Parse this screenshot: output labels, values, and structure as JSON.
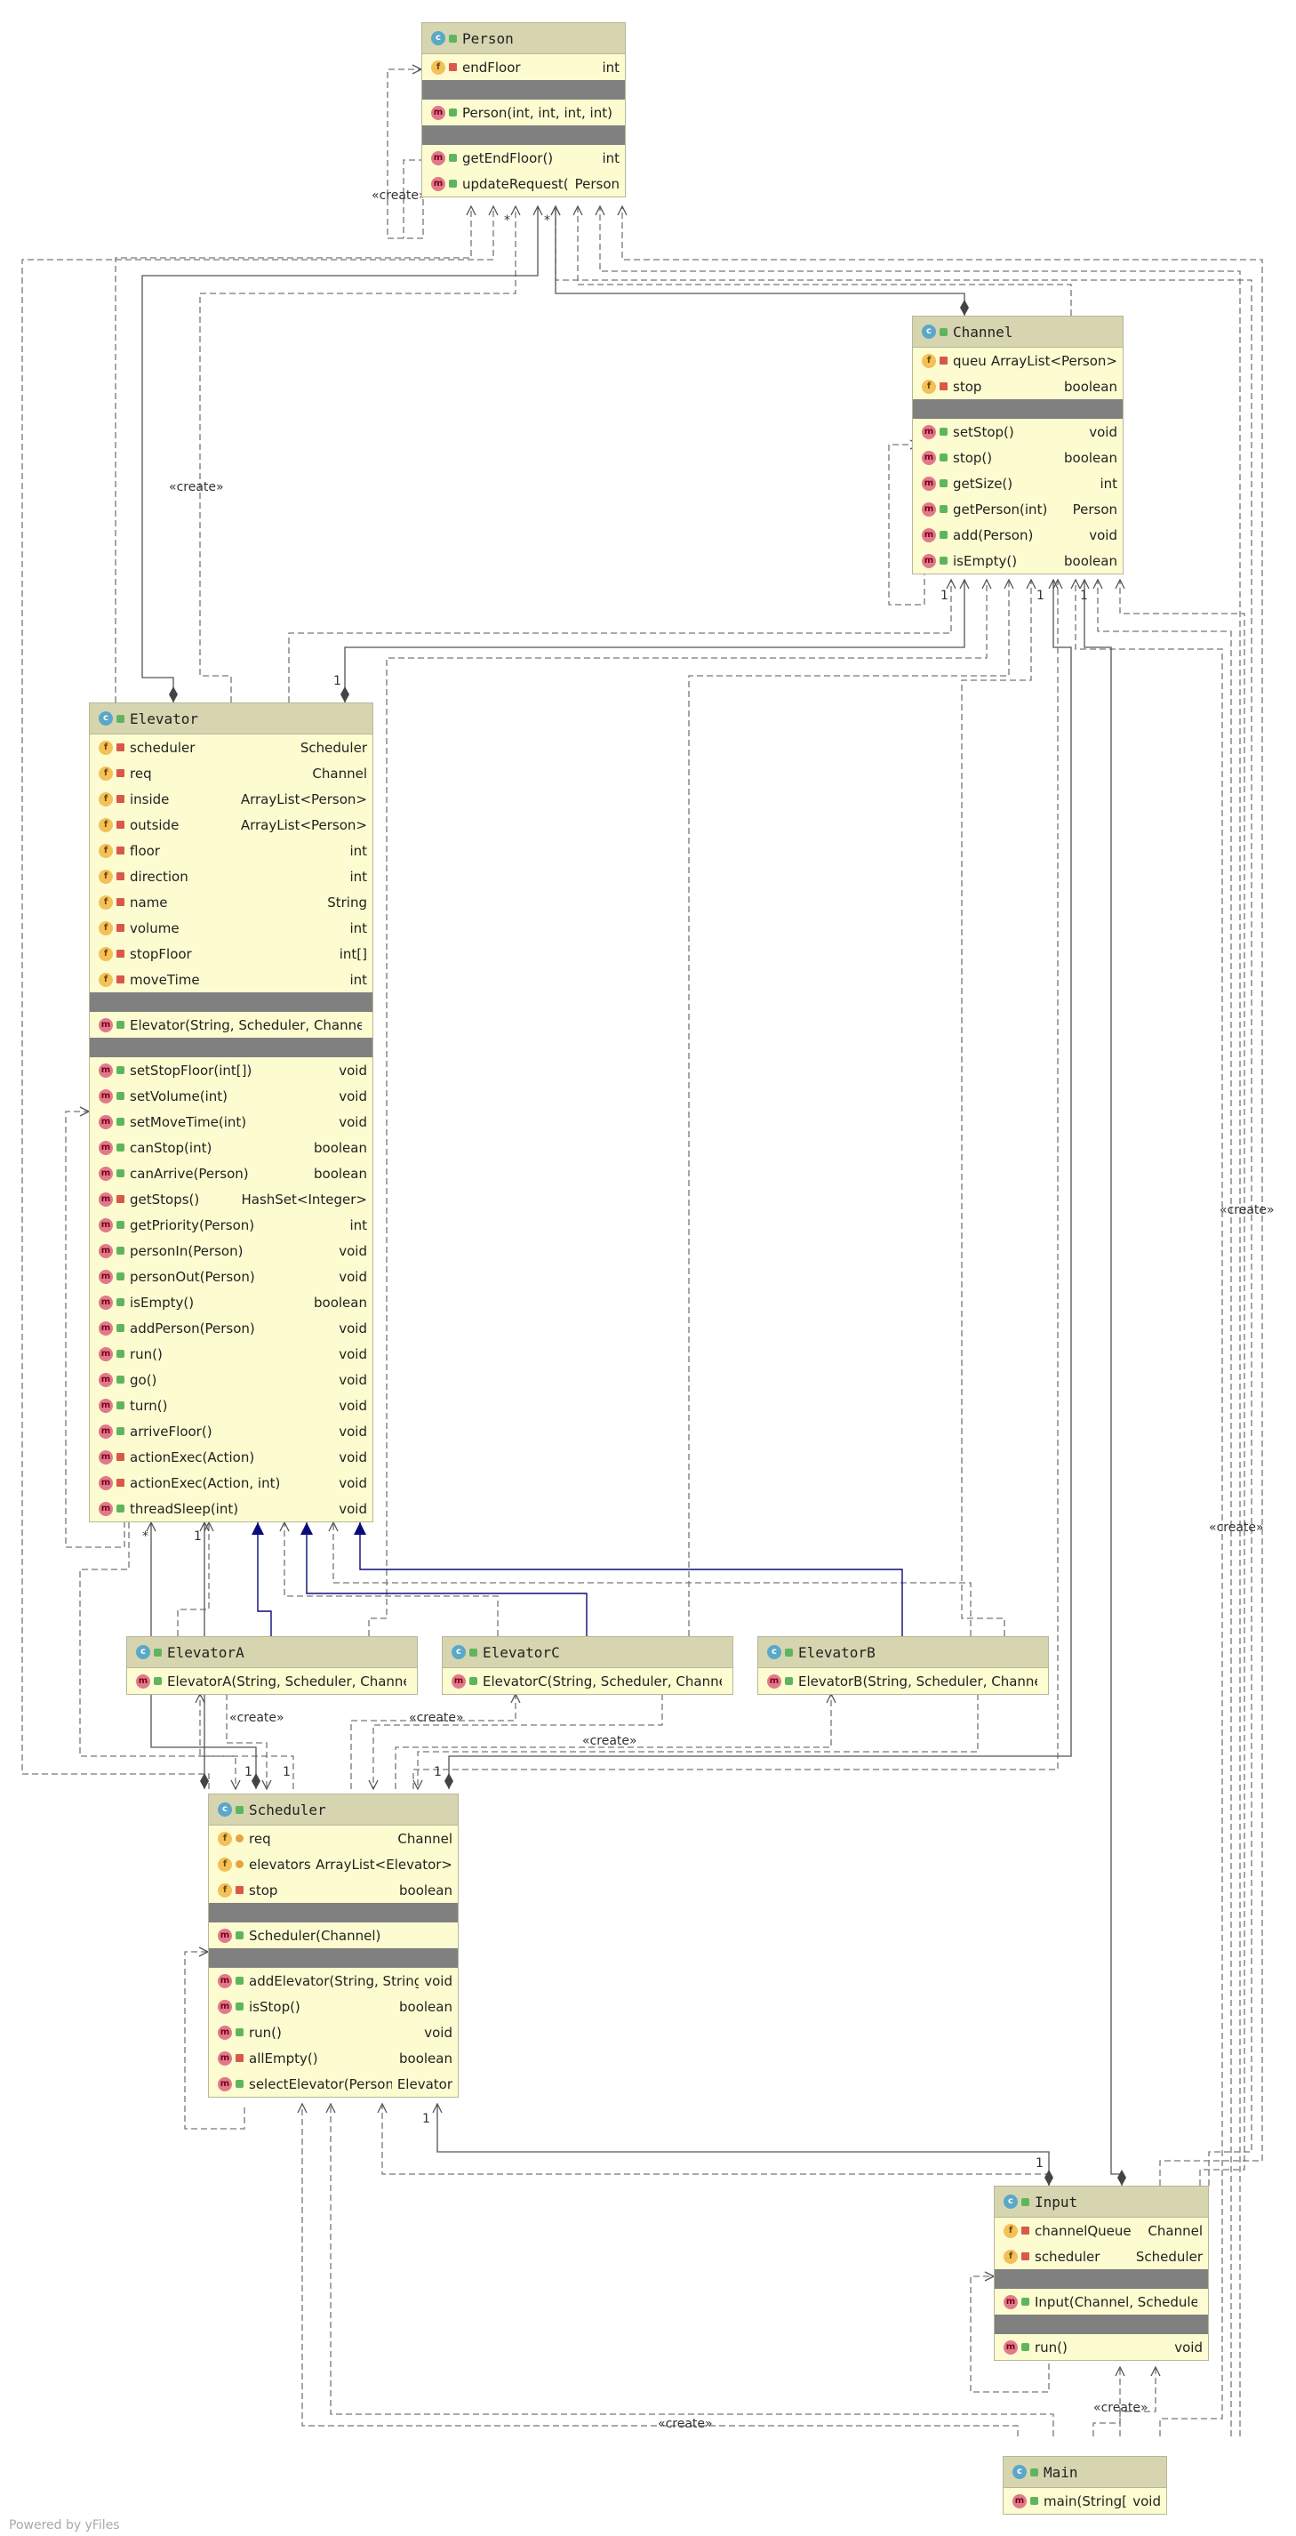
{
  "footer": "Powered by yFiles",
  "labels": {
    "create": "«create»",
    "many": "*",
    "one": "1"
  },
  "classes": {
    "person": {
      "name": "Person",
      "fields": [
        {
          "name": "endFloor",
          "type": "int",
          "vis": "priv"
        }
      ],
      "ctors": [
        {
          "name": "Person(int, int, int, int)",
          "type": "",
          "vis": "pub"
        }
      ],
      "methods": [
        {
          "name": "getEndFloor()",
          "type": "int",
          "vis": "pub"
        },
        {
          "name": "updateRequest()",
          "type": "Person",
          "vis": "pub"
        }
      ]
    },
    "channel": {
      "name": "Channel",
      "fields": [
        {
          "name": "queue",
          "type": "ArrayList<Person>",
          "vis": "priv"
        },
        {
          "name": "stop",
          "type": "boolean",
          "vis": "priv"
        }
      ],
      "ctors": [],
      "methods": [
        {
          "name": "setStop()",
          "type": "void",
          "vis": "pub"
        },
        {
          "name": "stop()",
          "type": "boolean",
          "vis": "pub"
        },
        {
          "name": "getSize()",
          "type": "int",
          "vis": "pub"
        },
        {
          "name": "getPerson(int)",
          "type": "Person",
          "vis": "pub"
        },
        {
          "name": "add(Person)",
          "type": "void",
          "vis": "pub"
        },
        {
          "name": "isEmpty()",
          "type": "boolean",
          "vis": "pub"
        }
      ]
    },
    "elevator": {
      "name": "Elevator",
      "fields": [
        {
          "name": "scheduler",
          "type": "Scheduler",
          "vis": "priv"
        },
        {
          "name": "req",
          "type": "Channel",
          "vis": "priv"
        },
        {
          "name": "inside",
          "type": "ArrayList<Person>",
          "vis": "priv"
        },
        {
          "name": "outside",
          "type": "ArrayList<Person>",
          "vis": "priv"
        },
        {
          "name": "floor",
          "type": "int",
          "vis": "priv"
        },
        {
          "name": "direction",
          "type": "int",
          "vis": "priv"
        },
        {
          "name": "name",
          "type": "String",
          "vis": "priv"
        },
        {
          "name": "volume",
          "type": "int",
          "vis": "priv"
        },
        {
          "name": "stopFloor",
          "type": "int[]",
          "vis": "priv"
        },
        {
          "name": "moveTime",
          "type": "int",
          "vis": "priv"
        }
      ],
      "ctors": [
        {
          "name": "Elevator(String, Scheduler, Channel)",
          "type": "",
          "vis": "pub"
        }
      ],
      "methods": [
        {
          "name": "setStopFloor(int[])",
          "type": "void",
          "vis": "pub"
        },
        {
          "name": "setVolume(int)",
          "type": "void",
          "vis": "pub"
        },
        {
          "name": "setMoveTime(int)",
          "type": "void",
          "vis": "pub"
        },
        {
          "name": "canStop(int)",
          "type": "boolean",
          "vis": "pub"
        },
        {
          "name": "canArrive(Person)",
          "type": "boolean",
          "vis": "pub"
        },
        {
          "name": "getStops()",
          "type": "HashSet<Integer>",
          "vis": "priv"
        },
        {
          "name": "getPriority(Person)",
          "type": "int",
          "vis": "pub"
        },
        {
          "name": "personIn(Person)",
          "type": "void",
          "vis": "pub"
        },
        {
          "name": "personOut(Person)",
          "type": "void",
          "vis": "pub"
        },
        {
          "name": "isEmpty()",
          "type": "boolean",
          "vis": "pub"
        },
        {
          "name": "addPerson(Person)",
          "type": "void",
          "vis": "pub"
        },
        {
          "name": "run()",
          "type": "void",
          "vis": "pub"
        },
        {
          "name": "go()",
          "type": "void",
          "vis": "pub"
        },
        {
          "name": "turn()",
          "type": "void",
          "vis": "pub"
        },
        {
          "name": "arriveFloor()",
          "type": "void",
          "vis": "pub"
        },
        {
          "name": "actionExec(Action)",
          "type": "void",
          "vis": "priv"
        },
        {
          "name": "actionExec(Action, int)",
          "type": "void",
          "vis": "priv"
        },
        {
          "name": "threadSleep(int)",
          "type": "void",
          "vis": "pub"
        }
      ]
    },
    "elevatorA": {
      "name": "ElevatorA",
      "fields": [],
      "ctors": [
        {
          "name": "ElevatorA(String, Scheduler, Channel)",
          "type": "",
          "vis": "pub"
        }
      ],
      "methods": []
    },
    "elevatorC": {
      "name": "ElevatorC",
      "fields": [],
      "ctors": [
        {
          "name": "ElevatorC(String, Scheduler, Channel)",
          "type": "",
          "vis": "pub"
        }
      ],
      "methods": []
    },
    "elevatorB": {
      "name": "ElevatorB",
      "fields": [],
      "ctors": [
        {
          "name": "ElevatorB(String, Scheduler, Channel)",
          "type": "",
          "vis": "pub"
        }
      ],
      "methods": []
    },
    "scheduler": {
      "name": "Scheduler",
      "fields": [
        {
          "name": "req",
          "type": "Channel",
          "vis": "pkg"
        },
        {
          "name": "elevators",
          "type": "ArrayList<Elevator>",
          "vis": "pkg"
        },
        {
          "name": "stop",
          "type": "boolean",
          "vis": "priv"
        }
      ],
      "ctors": [
        {
          "name": "Scheduler(Channel)",
          "type": "",
          "vis": "pub"
        }
      ],
      "methods": [
        {
          "name": "addElevator(String, String)",
          "type": "void",
          "vis": "pub"
        },
        {
          "name": "isStop()",
          "type": "boolean",
          "vis": "pub"
        },
        {
          "name": "run()",
          "type": "void",
          "vis": "pub"
        },
        {
          "name": "allEmpty()",
          "type": "boolean",
          "vis": "priv"
        },
        {
          "name": "selectElevator(Person)",
          "type": "Elevator",
          "vis": "pub"
        }
      ]
    },
    "input": {
      "name": "Input",
      "fields": [
        {
          "name": "channelQueue",
          "type": "Channel",
          "vis": "priv"
        },
        {
          "name": "scheduler",
          "type": "Scheduler",
          "vis": "priv"
        }
      ],
      "ctors": [
        {
          "name": "Input(Channel, Scheduler)",
          "type": "",
          "vis": "pub"
        }
      ],
      "methods": [
        {
          "name": "run()",
          "type": "void",
          "vis": "pub"
        }
      ]
    },
    "main": {
      "name": "Main",
      "fields": [],
      "ctors": [],
      "methods": [
        {
          "name": "main(String[])",
          "type": "void",
          "vis": "pub"
        }
      ],
      "inline": true
    }
  }
}
